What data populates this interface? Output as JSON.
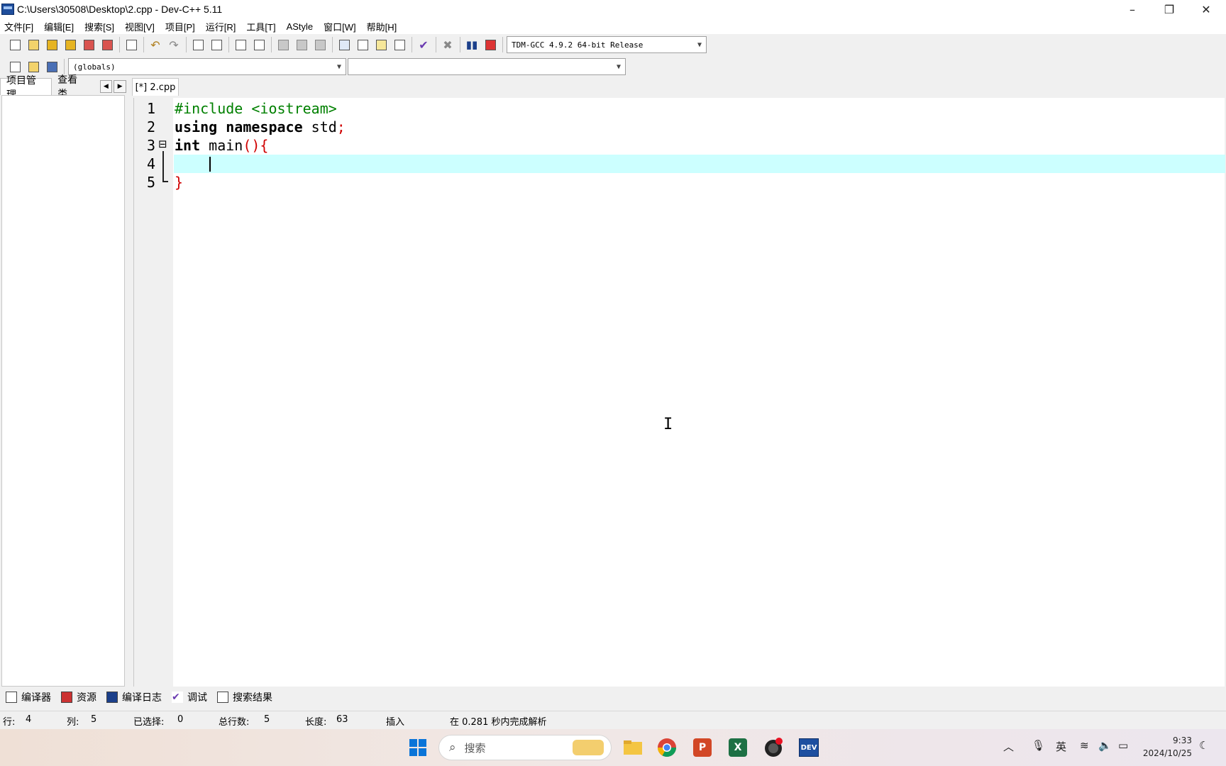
{
  "window": {
    "title": "C:\\Users\\30508\\Desktop\\2.cpp - Dev-C++ 5.11",
    "minimize": "–",
    "restore": "❐",
    "close": "✕"
  },
  "menu": [
    "文件[F]",
    "编辑[E]",
    "搜索[S]",
    "视图[V]",
    "项目[P]",
    "运行[R]",
    "工具[T]",
    "AStyle",
    "窗口[W]",
    "帮助[H]"
  ],
  "toolbar": {
    "compiler_select": "TDM-GCC 4.9.2 64-bit Release",
    "scope_select": "(globals)",
    "function_select": ""
  },
  "left_panel": {
    "tabs": [
      "项目管理",
      "查看类"
    ]
  },
  "editor": {
    "tab_label": "[*] 2.cpp",
    "line_numbers": [
      "1",
      "2",
      "3",
      "4",
      "5"
    ],
    "lines": {
      "l1_pp": "#include <iostream>",
      "l2_kw": "using namespace",
      "l2_rest": " std",
      "l2_sym": ";",
      "l3_kw": "int",
      "l3_rest": " main",
      "l3_sym": "(){",
      "l5_sym": "}"
    },
    "fold_marker": "⊟"
  },
  "bottom_tabs": [
    "编译器",
    "资源",
    "编译日志",
    "调试",
    "搜索结果"
  ],
  "status": {
    "row_label": "行:",
    "row": "4",
    "col_label": "列:",
    "col": "5",
    "sel_label": "已选择:",
    "sel": "0",
    "total_label": "总行数:",
    "total": "5",
    "len_label": "长度:",
    "len": "63",
    "mode": "插入",
    "message": "在 0.281 秒内完成解析"
  },
  "taskbar": {
    "search_placeholder": "搜索",
    "ime": "英",
    "time": "9:33",
    "date": "2024/10/25",
    "dev_label": "DEV",
    "ppt_label": "P",
    "excel_label": "X"
  }
}
